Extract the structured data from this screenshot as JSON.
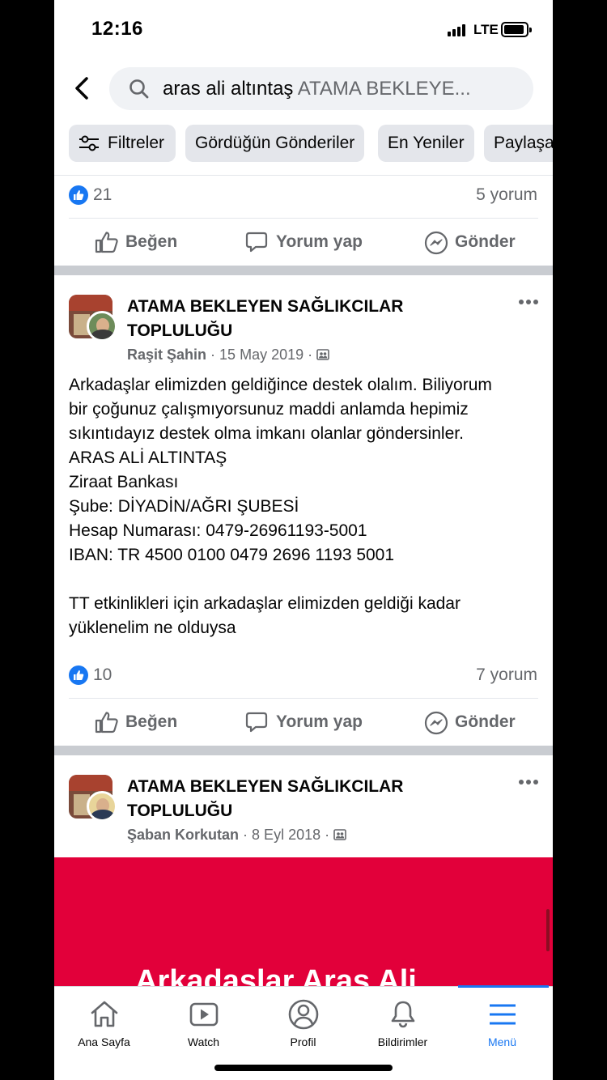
{
  "status_bar": {
    "time": "12:16",
    "network": "LTE"
  },
  "search": {
    "query": "aras ali altıntaş",
    "group_scope": "ATAMA BEKLEYE..."
  },
  "filters": {
    "items": [
      "Filtreler",
      "Gördüğün Gönderiler",
      "En Yeniler",
      "Paylaşa"
    ]
  },
  "posts": [
    {
      "likes": "21",
      "comments": "5 yorum",
      "actions": {
        "like": "Beğen",
        "comment": "Yorum yap",
        "send": "Gönder"
      }
    },
    {
      "group_name_line1": "ATAMA BEKLEYEN SAĞLIKCILAR",
      "group_name_line2": "TOPLULUĞU",
      "author": "Raşit Şahin",
      "date": "15 May 2019",
      "body": [
        "Arkadaşlar elimizden geldiğince destek olalım. Biliyorum",
        "bir çoğunuz çalışmıyorsunuz maddi anlamda hepimiz",
        "sıkıntıdayız destek olma imkanı olanlar göndersinler.",
        "ARAS ALİ ALTINTAŞ",
        "Ziraat Bankası",
        "Şube: DİYADİN/AĞRI ŞUBESİ",
        "Hesap Numarası: 0479-26961193-5001",
        "IBAN: TR 4500 0100 0479 2696 1193 5001",
        "",
        "TT etkinlikleri için arkadaşlar elimizden geldiği kadar",
        "yüklenelim ne olduysa"
      ],
      "likes": "10",
      "comments": "7 yorum",
      "actions": {
        "like": "Beğen",
        "comment": "Yorum yap",
        "send": "Gönder"
      }
    },
    {
      "group_name_line1": "ATAMA BEKLEYEN SAĞLIKCILAR",
      "group_name_line2": "TOPLULUĞU",
      "author": "Şaban Korkutan",
      "date": "8 Eyl 2018",
      "image_text": "Arkadaşlar Aras Ali"
    }
  ],
  "tabbar": {
    "items": [
      "Ana Sayfa",
      "Watch",
      "Profil",
      "Bildirimler",
      "Menü"
    ],
    "active": "Menü",
    "accent": "#1877f2"
  },
  "colors": {
    "brand": "#1877f2",
    "image_bg": "#e2003a"
  }
}
